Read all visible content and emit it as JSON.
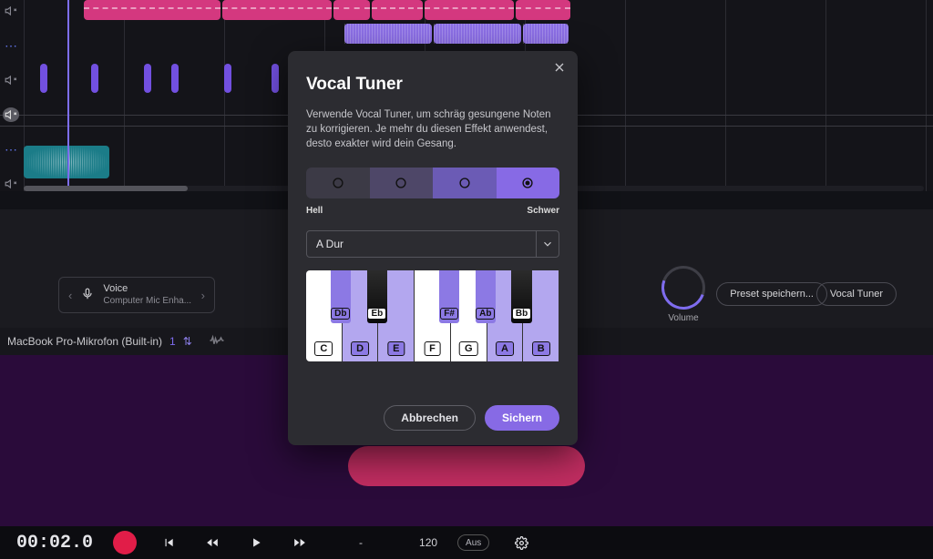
{
  "modal": {
    "title": "Vocal Tuner",
    "description": "Verwende Vocal Tuner, um schräg gesungene Noten zu korrigieren. Je mehr du diesen Effekt anwendest, desto exakter wird dein Gesang.",
    "intensity_min_label": "Hell",
    "intensity_max_label": "Schwer",
    "intensity_selected_index": 3,
    "scale_selected": "A Dur",
    "piano": {
      "white_keys": [
        {
          "note": "C",
          "on": false
        },
        {
          "note": "D",
          "on": true
        },
        {
          "note": "E",
          "on": true
        },
        {
          "note": "F",
          "on": false
        },
        {
          "note": "G",
          "on": false
        },
        {
          "note": "A",
          "on": true
        },
        {
          "note": "B",
          "on": true
        }
      ],
      "black_keys": [
        {
          "note": "Db",
          "left_pct": 9.6,
          "on": true
        },
        {
          "note": "Eb",
          "left_pct": 24.0,
          "on": false
        },
        {
          "note": "F#",
          "left_pct": 52.5,
          "on": true
        },
        {
          "note": "Ab",
          "left_pct": 66.8,
          "on": true
        },
        {
          "note": "Bb",
          "left_pct": 81.1,
          "on": false
        }
      ]
    },
    "cancel_label": "Abbrechen",
    "confirm_label": "Sichern"
  },
  "voice_box": {
    "title": "Voice",
    "subtitle": "Computer Mic Enha..."
  },
  "volume_label": "Volume",
  "preset_chip": "Preset speichern...",
  "vocal_chip": "Vocal Tuner",
  "mic_row": {
    "name": "MacBook Pro-Mikrofon (Built-in)",
    "index": "1"
  },
  "transport": {
    "timecode": "00:02.0",
    "sep": "-",
    "tempo": "120",
    "loop": "Aus"
  }
}
